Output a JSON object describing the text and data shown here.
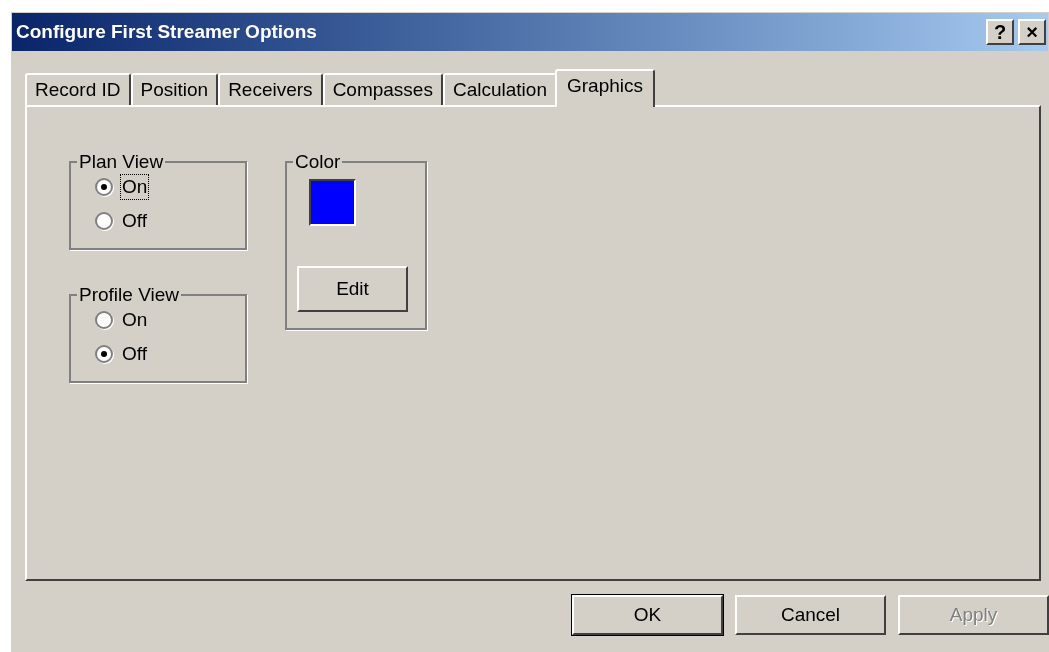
{
  "window": {
    "title": "Configure First Streamer Options",
    "title_buttons": [
      "?",
      "×"
    ]
  },
  "tabs": [
    {
      "label": "Record ID",
      "selected": false
    },
    {
      "label": "Position",
      "selected": false
    },
    {
      "label": "Receivers",
      "selected": false
    },
    {
      "label": "Compasses",
      "selected": false
    },
    {
      "label": "Calculation",
      "selected": false
    },
    {
      "label": "Graphics",
      "selected": true
    }
  ],
  "groups": [
    {
      "kind": "radio",
      "label": "Plan View",
      "options": [
        {
          "label": "On",
          "selected": true,
          "focused": true
        },
        {
          "label": "Off",
          "selected": false,
          "focused": false
        }
      ]
    },
    {
      "kind": "radio",
      "label": "Profile View",
      "options": [
        {
          "label": "On",
          "selected": false,
          "focused": false
        },
        {
          "label": "Off",
          "selected": true,
          "focused": false
        }
      ]
    },
    {
      "kind": "color",
      "label": "Color",
      "color": "#0000ff",
      "button": "Edit"
    }
  ],
  "buttons": [
    {
      "label": "OK",
      "default": true,
      "disabled": false
    },
    {
      "label": "Cancel",
      "default": false,
      "disabled": false
    },
    {
      "label": "Apply",
      "default": false,
      "disabled": true
    }
  ]
}
